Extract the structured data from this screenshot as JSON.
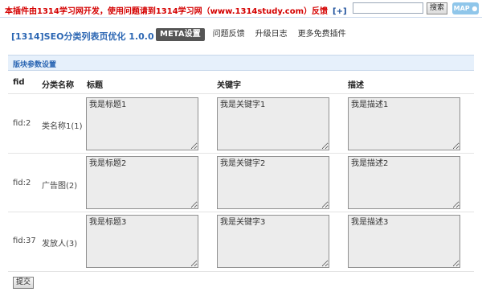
{
  "topbar": {
    "notice": "本插件由1314学习网开发，使用问题请到1314学习网（www.1314study.com）反馈",
    "notice_link": "[+]",
    "search_value": "",
    "search_button": "搜索",
    "map_button": "MAP ●"
  },
  "header": {
    "title": "[1314]SEO分类列表页优化 1.0.0",
    "tabs": [
      "META设置",
      "问题反馈",
      "升级日志",
      "更多免费插件"
    ],
    "active_tab": "META设置"
  },
  "section": {
    "title": "版块参数设置"
  },
  "table": {
    "columns": [
      "fid",
      "分类名称",
      "标题",
      "关键字",
      "描述"
    ],
    "rows": [
      {
        "fid": "fid:2",
        "name": "类名称1(1)",
        "title": "我是标题1",
        "keywords": "我是关键字1",
        "description": "我是描述1"
      },
      {
        "fid": "fid:2",
        "name": "广告图(2)",
        "title": "我是标题2",
        "keywords": "我是关键字2",
        "description": "我是描述2"
      },
      {
        "fid": "fid:37",
        "name": "发放人(3)",
        "title": "我是标题3",
        "keywords": "我是关键字3",
        "description": "我是描述3"
      }
    ]
  },
  "footer": {
    "submit_label": "提交"
  },
  "colors": {
    "accent": "#2b66b3",
    "notice": "#d40000",
    "section_bg": "#e6f0fb",
    "map_button": "#8fc6ea"
  }
}
